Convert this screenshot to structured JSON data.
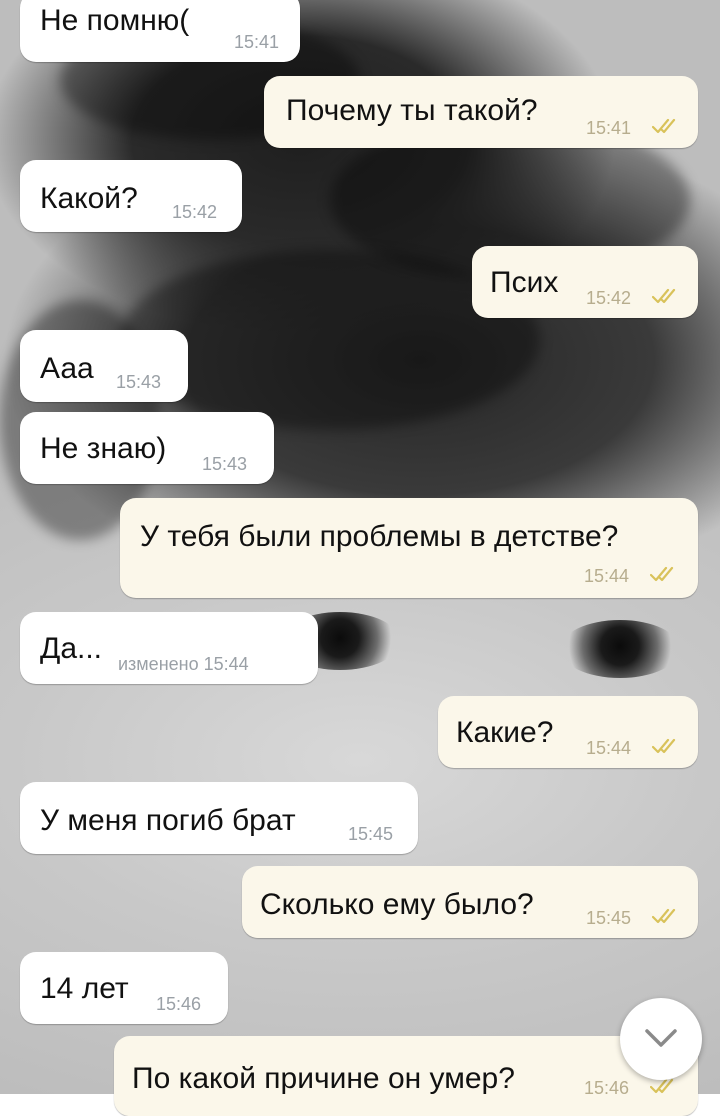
{
  "messages": [
    {
      "text": "Не помню(",
      "time": "15:41",
      "dir": "in"
    },
    {
      "text": "Почему ты такой?",
      "time": "15:41",
      "dir": "out"
    },
    {
      "text": "Какой?",
      "time": "15:42",
      "dir": "in"
    },
    {
      "text": "Псих",
      "time": "15:42",
      "dir": "out"
    },
    {
      "text": "Ааа",
      "time": "15:43",
      "dir": "in"
    },
    {
      "text": "Не знаю)",
      "time": "15:43",
      "dir": "in"
    },
    {
      "text": "У тебя были проблемы в детстве?",
      "time": "15:44",
      "dir": "out"
    },
    {
      "text": "Да...",
      "time": "изменено 15:44",
      "dir": "in"
    },
    {
      "text": "Какие?",
      "time": "15:44",
      "dir": "out"
    },
    {
      "text": "У меня погиб брат",
      "time": "15:45",
      "dir": "in"
    },
    {
      "text": "Сколько ему было?",
      "time": "15:45",
      "dir": "out"
    },
    {
      "text": "14 лет",
      "time": "15:46",
      "dir": "in"
    },
    {
      "text": "По какой причине он умер?",
      "time": "15:46",
      "dir": "out"
    }
  ],
  "icons": {
    "read_ticks": "double-check-icon",
    "scroll_down": "chevron-down-icon"
  },
  "colors": {
    "incoming_bubble": "#ffffff",
    "outgoing_bubble": "#fbf7ea",
    "read_ticks": "#d9c25a",
    "timestamp": "#9aa0a6"
  }
}
